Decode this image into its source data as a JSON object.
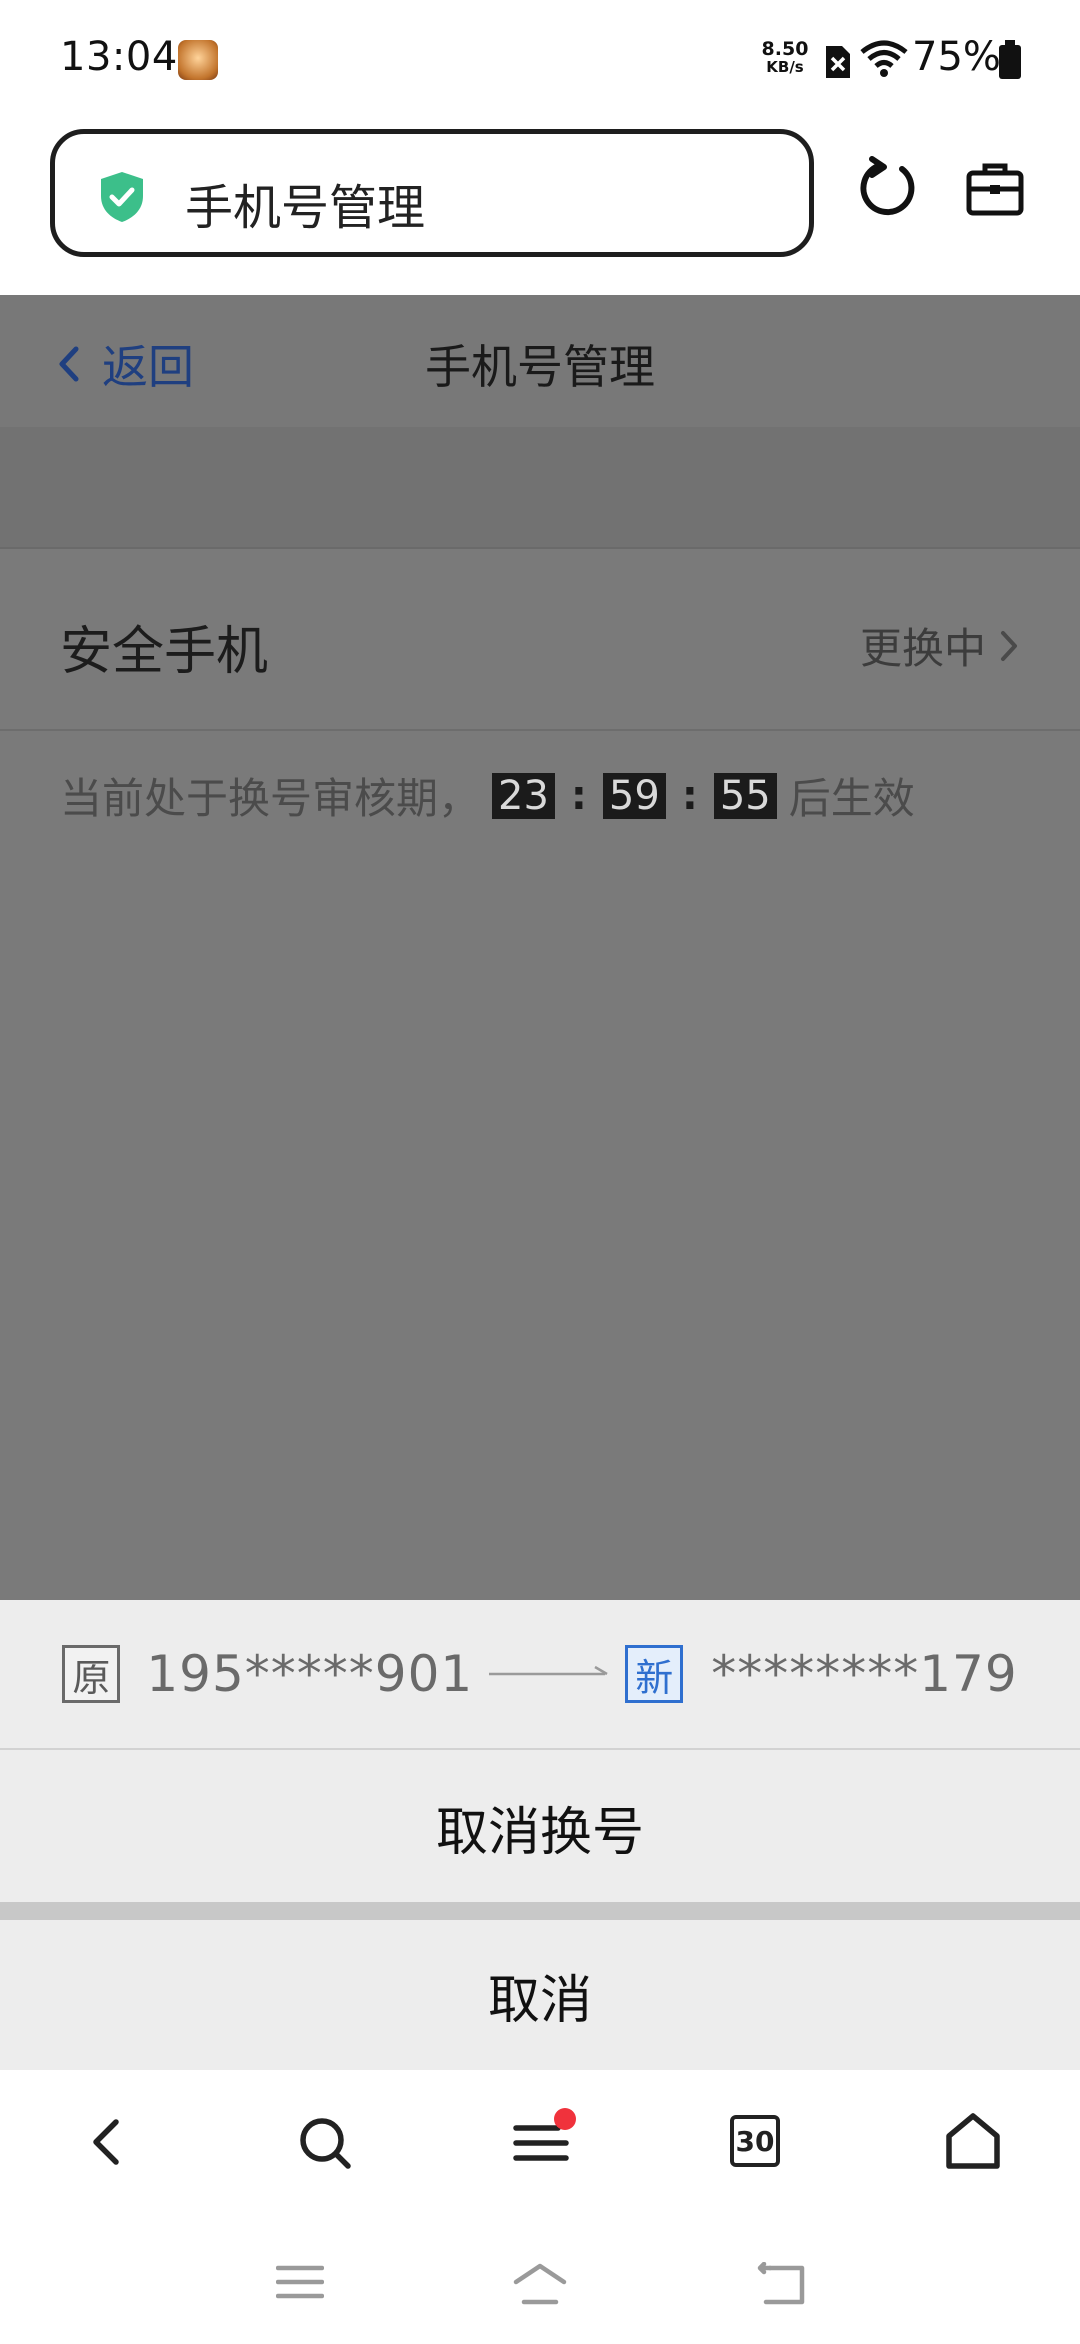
{
  "status_bar": {
    "time": "13:04",
    "net_speed_value": "8.50",
    "net_speed_unit": "KB/s",
    "battery": "75%"
  },
  "url_bar": {
    "title": "手机号管理",
    "icons": [
      "shield-check-icon",
      "refresh-icon",
      "toolbox-icon"
    ]
  },
  "page": {
    "back_label": "返回",
    "title": "手机号管理",
    "row_label": "安全手机",
    "row_status": "更换中",
    "notice_prefix": "当前处于换号审核期，",
    "countdown": {
      "hours": "23",
      "minutes": "59",
      "seconds": "55"
    },
    "colon": ":",
    "notice_suffix": "后生效"
  },
  "sheet": {
    "old_tag": "原",
    "old_number": "195*****901",
    "new_tag": "新",
    "new_number": "********179",
    "action_label": "取消换号",
    "cancel_label": "取消"
  },
  "toolbar": {
    "tab_count": "30",
    "icons": [
      "back-icon",
      "search-icon",
      "menu-icon",
      "tabs-icon",
      "home-icon"
    ]
  },
  "colors": {
    "accent_blue": "#2f6fcf",
    "badge_red": "#f0323c",
    "shield_green": "#3cbf8a"
  }
}
